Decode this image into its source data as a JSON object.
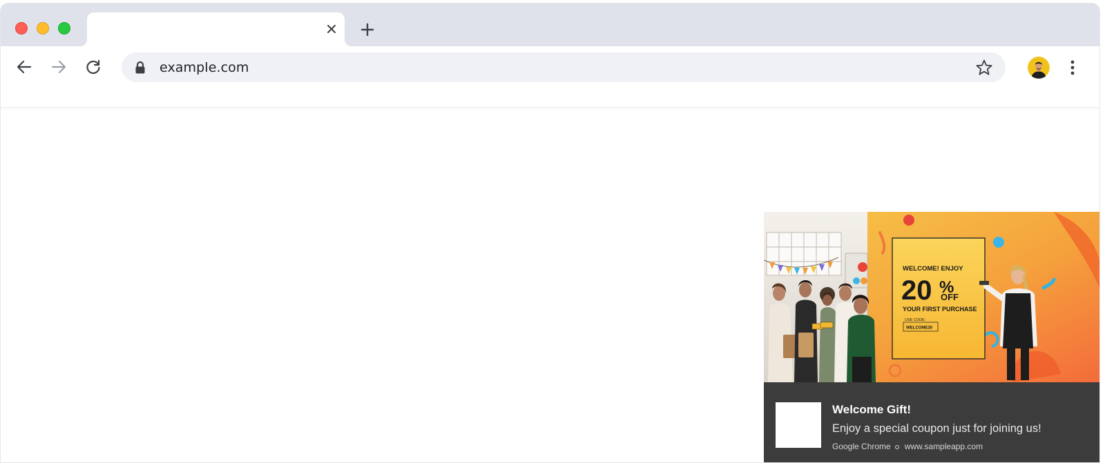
{
  "browser": {
    "tab": {
      "title": "",
      "close_icon": "close-icon"
    },
    "new_tab_icon": "plus-icon",
    "toolbar": {
      "back_icon": "arrow-left-icon",
      "forward_icon": "arrow-right-icon",
      "reload_icon": "reload-icon",
      "lock_icon": "lock-icon",
      "url": "example.com",
      "bookmark_icon": "star-icon",
      "profile_icon": "avatar",
      "menu_icon": "kebab-menu-icon"
    },
    "colors": {
      "tabstrip_bg": "#dfe2ea",
      "omnibox_bg": "#eff1f5",
      "notification_bg": "#3c3c3c",
      "traffic_red": "#fe5f57",
      "traffic_yellow": "#febc2e",
      "traffic_green": "#28c840"
    }
  },
  "notification": {
    "image": {
      "headline": "WELCOME! ENJOY",
      "discount_number": "20",
      "discount_percent": "%",
      "discount_off": "OFF",
      "subline": "YOUR FIRST PURCHASE",
      "code_label": "USE CODE:",
      "code": "WELCOME20"
    },
    "title": "Welcome Gift!",
    "message": "Enjoy a special coupon just for joining us!",
    "source": "Google Chrome",
    "site": "www.sampleapp.com"
  }
}
